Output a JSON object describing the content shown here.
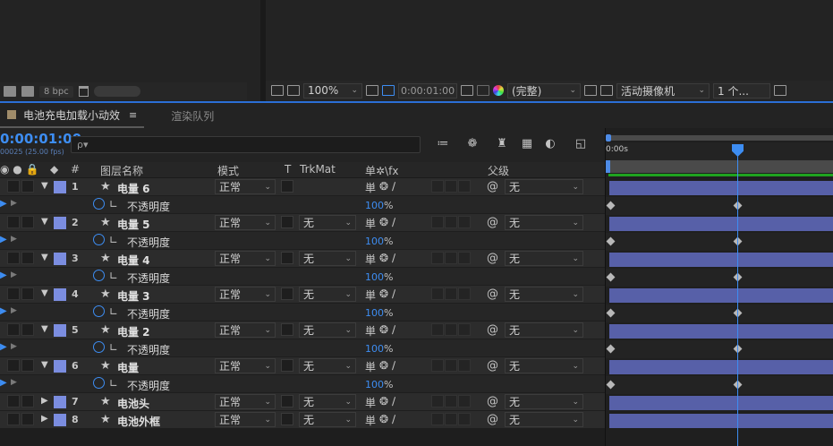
{
  "project": {
    "bpc": "8 bpc"
  },
  "viewer": {
    "zoom": "100%",
    "timecode": "0:00:01:00",
    "resolution": "(完整)",
    "camera": "活动摄像机",
    "views": "1 个..."
  },
  "timeline": {
    "comp_tab": "电池充电加载小动效",
    "render_queue_tab": "渲染队列",
    "current_time": "0:00:01:00",
    "fps": "00025 (25.00 fps)",
    "search_placeholder": "ρ▾",
    "ruler_start": "0:00s"
  },
  "columns": {
    "hash": "#",
    "layer_name": "图层名称",
    "mode": "模式",
    "t": "T",
    "trkmat": "TrkMat",
    "switches": "单✲\\fx",
    "parent": "父级"
  },
  "layers": [
    {
      "num": "1",
      "name": "电量 6",
      "mode": "正常",
      "trkmat": "",
      "parent": "无",
      "expanded": true,
      "prop": "不透明度",
      "value": "100",
      "unit": "%"
    },
    {
      "num": "2",
      "name": "电量 5",
      "mode": "正常",
      "trkmat": "无",
      "parent": "无",
      "expanded": true,
      "prop": "不透明度",
      "value": "100",
      "unit": "%"
    },
    {
      "num": "3",
      "name": "电量 4",
      "mode": "正常",
      "trkmat": "无",
      "parent": "无",
      "expanded": true,
      "prop": "不透明度",
      "value": "100",
      "unit": "%"
    },
    {
      "num": "4",
      "name": "电量 3",
      "mode": "正常",
      "trkmat": "无",
      "parent": "无",
      "expanded": true,
      "prop": "不透明度",
      "value": "100",
      "unit": "%"
    },
    {
      "num": "5",
      "name": "电量 2",
      "mode": "正常",
      "trkmat": "无",
      "parent": "无",
      "expanded": true,
      "prop": "不透明度",
      "value": "100",
      "unit": "%"
    },
    {
      "num": "6",
      "name": "电量",
      "mode": "正常",
      "trkmat": "无",
      "parent": "无",
      "expanded": true,
      "prop": "不透明度",
      "value": "100",
      "unit": "%"
    },
    {
      "num": "7",
      "name": "电池头",
      "mode": "正常",
      "trkmat": "无",
      "parent": "无",
      "expanded": false
    },
    {
      "num": "8",
      "name": "电池外框",
      "mode": "正常",
      "trkmat": "无",
      "parent": "无",
      "expanded": false
    }
  ],
  "colors": {
    "accent": "#3d8df2",
    "label": "#7b8de0",
    "layer_bar": "#5760a8",
    "work_area_line": "#1fa21f"
  }
}
